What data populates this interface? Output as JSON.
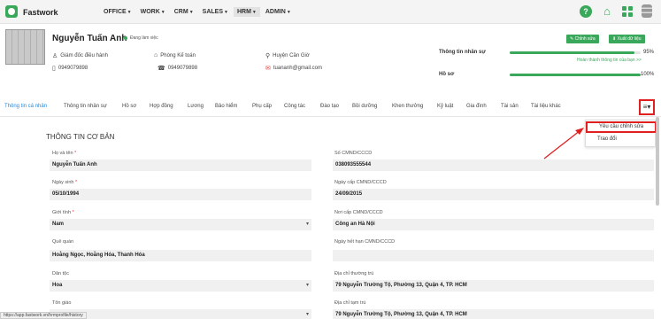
{
  "brand": {
    "name": "Fastwork"
  },
  "menu": [
    {
      "label": "OFFICE",
      "active": false
    },
    {
      "label": "WORK",
      "active": false
    },
    {
      "label": "CRM",
      "active": false
    },
    {
      "label": "SALES",
      "active": false
    },
    {
      "label": "HRM",
      "active": true
    },
    {
      "label": "ADMIN",
      "active": false
    }
  ],
  "profile": {
    "name": "Nguyễn Tuấn Anh",
    "status": "Đang làm việc",
    "position": "Giám đốc điều hành",
    "department": "Phòng Kế toán",
    "location": "Huyện Cần Giờ",
    "phone1": "0949079898",
    "phone2": "0949079898",
    "email": "tuananh@gmail.com",
    "edit_button": "Chỉnh sửa",
    "export_button": "Xuất dữ liệu",
    "stats": {
      "staff_info_label": "Thông tin nhân sự",
      "staff_info_pct": "95%",
      "staff_info_value": 95,
      "complete_link": "Hoàn thành thông tin của bạn >>",
      "profile_label": "Hồ sơ",
      "profile_pct": "100%",
      "profile_value": 100
    }
  },
  "tabs": [
    "Thông tin cá nhân",
    "Thông tin nhân sự",
    "Hồ sơ",
    "Hợp đồng",
    "Lương",
    "Bảo hiểm",
    "Phụ cấp",
    "Công tác",
    "Đào tạo",
    "Bồi dưỡng",
    "Khen thưởng",
    "Kỷ luật",
    "Gia đình",
    "Tài sản",
    "Tài liệu khác"
  ],
  "more_menu": {
    "icon": "list-icon",
    "items": [
      "Yêu cầu chỉnh sửa",
      "Trao đổi"
    ]
  },
  "section": {
    "title": "THÔNG TIN CƠ BẢN",
    "left": [
      {
        "label": "Họ và tên",
        "required": true,
        "value": "Nguyễn Tuấn Anh",
        "select": false
      },
      {
        "label": "Ngày sinh",
        "required": true,
        "value": "05/10/1994",
        "select": false
      },
      {
        "label": "Giới tính",
        "required": true,
        "value": "Nam",
        "select": true
      },
      {
        "label": "Quê quán",
        "required": false,
        "value": "Hoằng Ngọc, Hoằng Hóa, Thanh Hóa",
        "select": false
      },
      {
        "label": "Dân tộc",
        "required": false,
        "value": "Hoa",
        "select": true
      },
      {
        "label": "Tôn giáo",
        "required": false,
        "value": "",
        "select": true
      }
    ],
    "right": [
      {
        "label": "Số CMND/CCCD",
        "value": "038093555544",
        "select": false
      },
      {
        "label": "Ngày cấp CMND/CCCD",
        "value": "24/09/2015",
        "select": false
      },
      {
        "label": "Nơi cấp CMND/CCCD",
        "value": "Công an Hà Nội",
        "select": false
      },
      {
        "label": "Ngày hết hạn CMND/CCCD",
        "value": "",
        "select": false
      },
      {
        "label": "Địa chỉ thường trú",
        "value": "79 Nguyễn Trường Tộ, Phường 13, Quận 4, TP. HCM",
        "select": false
      },
      {
        "label": "Địa chỉ tạm trú",
        "value": "79 Nguyễn Trường Tộ, Phường 13, Quận 4, TP. HCM",
        "select": false
      }
    ]
  },
  "status_url": "https://app.fastwork.vn/hrmprofile/history"
}
